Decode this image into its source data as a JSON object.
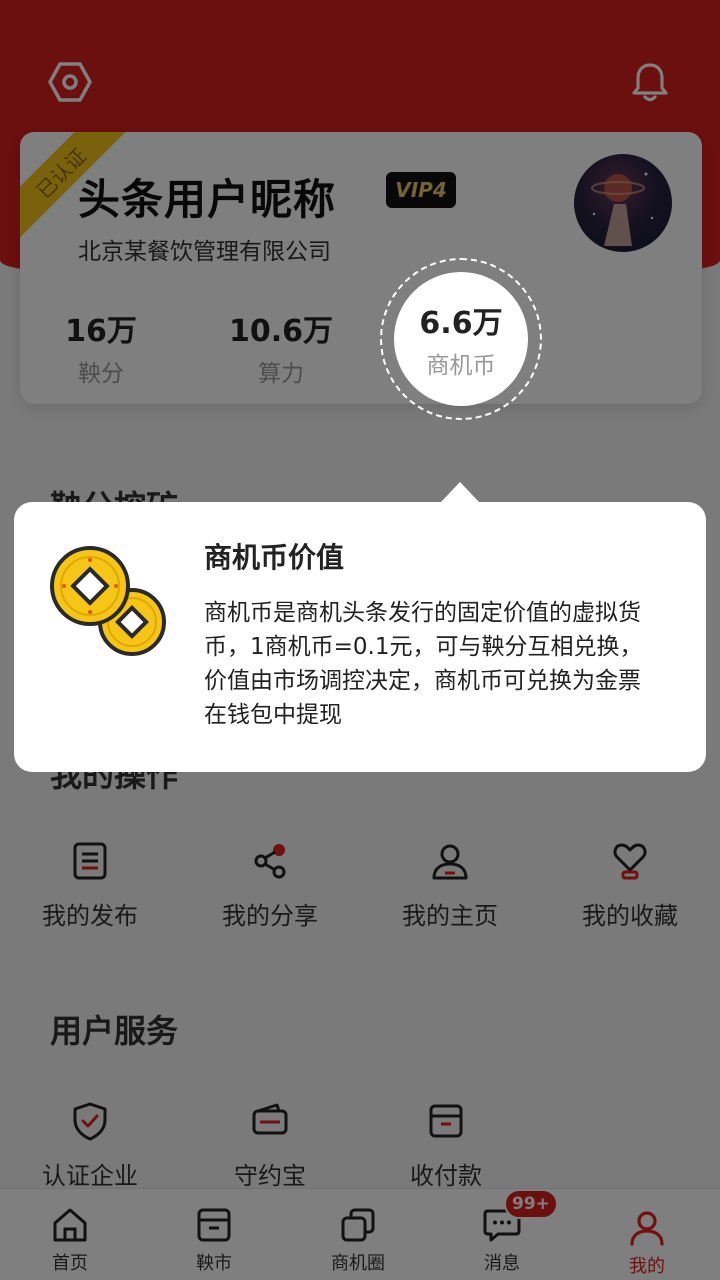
{
  "profile": {
    "verified_label": "已认证",
    "username": "头条用户昵称",
    "vip_label": "VIP4",
    "company": "北京某餐饮管理有限公司",
    "stats": [
      {
        "value": "16万",
        "label": "鞅分"
      },
      {
        "value": "10.6万",
        "label": "算力"
      },
      {
        "value": "6.6万",
        "label": "商机币"
      }
    ]
  },
  "sections": {
    "mining_title": "鞅分挖矿",
    "operations_title": "我的操作",
    "services_title": "用户服务"
  },
  "operations": [
    {
      "label": "我的发布",
      "icon": "document-list-icon"
    },
    {
      "label": "我的分享",
      "icon": "share-icon"
    },
    {
      "label": "我的主页",
      "icon": "user-icon"
    },
    {
      "label": "我的收藏",
      "icon": "heart-favorite-icon"
    }
  ],
  "services": [
    {
      "label": "认证企业",
      "icon": "shield-check-icon"
    },
    {
      "label": "守约宝",
      "icon": "wallet-icon"
    },
    {
      "label": "收付款",
      "icon": "payment-box-icon"
    }
  ],
  "tooltip": {
    "title": "商机币价值",
    "body": "商机币是商机头条发行的固定价值的虚拟货币，1商机币=0.1元，可与鞅分互相兑换，价值由市场调控决定，商机币可兑换为金票在钱包中提现"
  },
  "tabbar": [
    {
      "label": "首页",
      "icon": "home-icon"
    },
    {
      "label": "鞅市",
      "icon": "market-box-icon"
    },
    {
      "label": "商机圈",
      "icon": "circle-squares-icon"
    },
    {
      "label": "消息",
      "icon": "chat-bubble-icon",
      "badge": "99+"
    },
    {
      "label": "我的",
      "icon": "person-icon",
      "active": true
    }
  ],
  "colors": {
    "brand_red": "#d81e1e",
    "active_tab": "#e02020",
    "vip_gold": "#e8c76a",
    "ribbon_yellow": "#f5c518"
  }
}
